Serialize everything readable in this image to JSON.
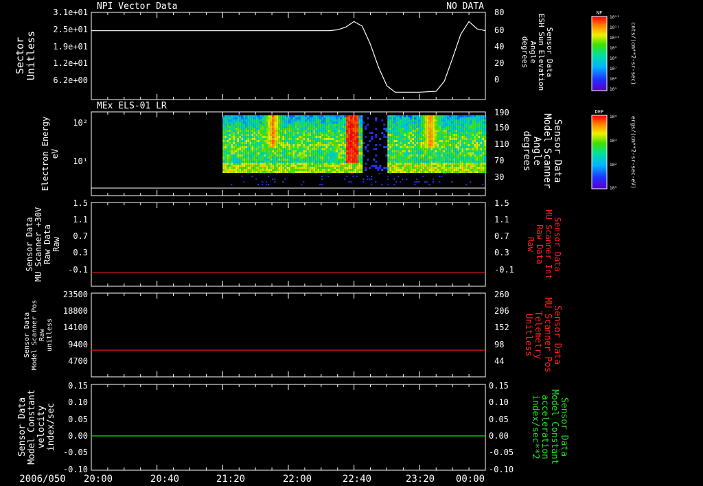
{
  "colors": {
    "background": "#000000",
    "axis": "#ffffff",
    "red_trace": "#e01818",
    "green_trace": "#1ee01e",
    "white_trace": "#ffffff"
  },
  "time_axis": {
    "date_label": "2006/050",
    "tick_labels": [
      "20:00",
      "20:40",
      "21:20",
      "22:00",
      "22:40",
      "23:20",
      "00:00"
    ]
  },
  "panel1": {
    "title_left": "NPI Vector Data",
    "title_right": "NO DATA",
    "left_label": [
      "Sector",
      "Unitless"
    ],
    "left_ticks": [
      "3.1e+01",
      "2.5e+01",
      "1.9e+01",
      "1.2e+01",
      "6.2e+00"
    ],
    "right_label": [
      "Sensor Data",
      "ESH Sun Elevation",
      "Angle",
      "degrees"
    ],
    "right_ticks": [
      "80",
      "60",
      "40",
      "20",
      "0"
    ]
  },
  "panel2": {
    "title_left": "MEx ELS-01 LR",
    "left_label": [
      "Electron Energy",
      "eV"
    ],
    "left_ticks": [
      "10²",
      "10¹"
    ],
    "right_label": [
      "Sensor Data",
      "Model Scanner",
      "Angle",
      "degrees"
    ],
    "right_ticks": [
      "190",
      "150",
      "110",
      "70",
      "30"
    ]
  },
  "panel3": {
    "left_label": [
      "Sensor Data",
      "MU Scanner +30V",
      "Raw Data",
      "Raw"
    ],
    "left_ticks": [
      "1.5",
      "1.1",
      "0.7",
      "0.3",
      "-0.1"
    ],
    "right_label": [
      "Sensor Data",
      "MU Scanner Int",
      "Raw Data",
      "Raw"
    ],
    "right_ticks": [
      "1.5",
      "1.1",
      "0.7",
      "0.3",
      "-0.1"
    ]
  },
  "panel4": {
    "left_label": [
      "Sensor Data",
      "Model Scanner Pos",
      "Raw",
      "unitless"
    ],
    "left_ticks": [
      "23500",
      "18800",
      "14100",
      "9400",
      "4700"
    ],
    "right_label": [
      "Sensor Data",
      "MU Scanner Pos",
      "Telemetry",
      "Unitless"
    ],
    "right_ticks": [
      "260",
      "206",
      "152",
      "98",
      "44"
    ]
  },
  "panel5": {
    "left_label": [
      "Sensor Data",
      "Model Constant",
      "velocity",
      "index/sec"
    ],
    "left_ticks": [
      "0.15",
      "0.10",
      "0.05",
      "0.00",
      "-0.05",
      "-0.10"
    ],
    "right_label": [
      "Sensor Data",
      "Model Constant",
      "acceleration",
      "index/sec**2"
    ],
    "right_ticks": [
      "0.15",
      "0.10",
      "0.05",
      "0.00",
      "-0.05",
      "-0.10"
    ]
  },
  "colorbar1": {
    "title": "NF",
    "unit_label": "cnts/(cm**2-sr-sec)",
    "ticks": [
      "10¹²",
      "10¹¹",
      "10¹⁰",
      "10⁹",
      "10⁸",
      "10⁷",
      "10⁶",
      "10⁵"
    ]
  },
  "colorbar2": {
    "title": "DEF",
    "unit_label": "ergs/(cm**2-sr-sec-eV)",
    "ticks": [
      "10⁴",
      "10³",
      "10²",
      "10¹"
    ]
  },
  "chart_data": [
    {
      "type": "line",
      "panel": "panel1",
      "series": [
        {
          "name": "ESH Sun Elevation Angle",
          "x": [
            "20:00",
            "22:25",
            "22:30",
            "22:35",
            "22:40",
            "22:45",
            "22:50",
            "22:55",
            "23:00",
            "23:05",
            "23:10",
            "23:20",
            "23:30",
            "23:35",
            "23:40",
            "23:45",
            "23:50",
            "23:55",
            "00:00"
          ],
          "values": [
            60,
            60,
            61,
            64,
            70,
            65,
            45,
            20,
            0,
            -7,
            -7,
            -7,
            -6,
            5,
            30,
            56,
            70,
            62,
            60
          ]
        }
      ],
      "ylim": [
        -15,
        80
      ]
    },
    {
      "type": "heatmap",
      "panel": "panel2",
      "description_note": "",
      "x_range": [
        "20:00",
        "00:00"
      ],
      "ylim_eV": [
        2,
        200
      ],
      "data_start": "21:20",
      "bright_features": [
        {
          "time": "21:50",
          "energy_eV_range": [
            40,
            150
          ],
          "level": "high"
        },
        {
          "time": "22:38",
          "energy_eV_range": [
            5,
            200
          ],
          "level": "very high"
        },
        {
          "time": "23:26",
          "energy_eV_range": [
            40,
            200
          ],
          "level": "high"
        }
      ],
      "gap": [
        "22:45",
        "23:00"
      ]
    },
    {
      "type": "line",
      "panel": "panel3",
      "series": [
        {
          "name": "MU Scanner Int Raw Data",
          "x": [
            "20:00",
            "00:00"
          ],
          "values": [
            0.0,
            0.0
          ]
        }
      ],
      "ylim": [
        -0.3,
        1.5
      ]
    },
    {
      "type": "line",
      "panel": "panel4",
      "series": [
        {
          "name": "MU Scanner Pos Telemetry",
          "x": [
            "20:00",
            "00:00"
          ],
          "values": [
            83,
            83
          ]
        }
      ],
      "ylim": [
        0,
        260
      ]
    },
    {
      "type": "line",
      "panel": "panel5",
      "series": [
        {
          "name": "Model Constant acceleration",
          "x": [
            "20:00",
            "00:00"
          ],
          "values": [
            0.0,
            0.0
          ]
        }
      ],
      "ylim": [
        -0.1,
        0.15
      ]
    }
  ]
}
